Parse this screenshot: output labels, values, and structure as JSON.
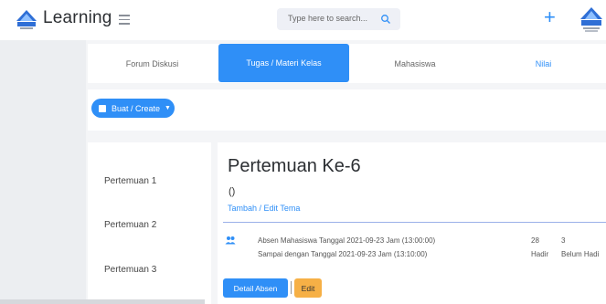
{
  "header": {
    "app_title": "Learning",
    "search_placeholder": "Type here to search..."
  },
  "tabs": [
    {
      "label": "Forum Diskusi"
    },
    {
      "label": "Tugas / Materi Kelas"
    },
    {
      "label": "Mahasiswa"
    },
    {
      "label": "Nilai"
    }
  ],
  "create_button": {
    "label": "Buat / Create"
  },
  "meetings": [
    {
      "label": "Pertemuan 1"
    },
    {
      "label": "Pertemuan 2"
    },
    {
      "label": "Pertemuan 3"
    }
  ],
  "detail": {
    "title": "Pertemuan Ke-6",
    "subtitle": "()",
    "edit_link": "Tambah / Edit Tema",
    "attendance": {
      "line1": "Absen Mahasiswa Tanggal 2021-09-23 Jam (13:00:00)",
      "line2": "Sampai dengan Tanggal 2021-09-23 Jam (13:10:00)",
      "hadir_count": "28",
      "hadir_label": "Hadir",
      "belum_count": "3",
      "belum_label": "Belum Hadi"
    },
    "detail_button": "Detail Absen",
    "separator": "|",
    "edit_button": "Edit"
  },
  "colors": {
    "accent": "#2f8ff7",
    "edit_button": "#f6b046"
  }
}
